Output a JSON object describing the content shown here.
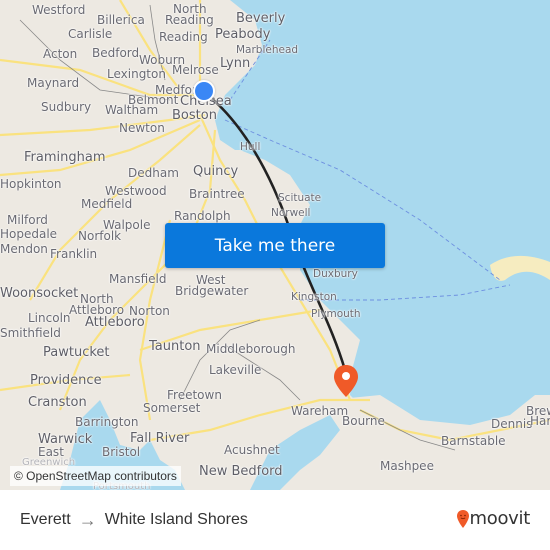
{
  "map": {
    "origin": {
      "name": "Everett",
      "marker_color": "#3a87f5"
    },
    "destination": {
      "name": "White Island Shores",
      "marker_color": "#f05a28"
    },
    "route_color": "#222222",
    "water_color": "#a9d9ee",
    "land_color": "#ede9e2",
    "road_color": "#fbe27a",
    "attribution": "© OpenStreetMap contributors",
    "places": [
      {
        "name": "Westford"
      },
      {
        "name": "North Reading"
      },
      {
        "name": "Beverly"
      },
      {
        "name": "Billerica"
      },
      {
        "name": "Carlisle"
      },
      {
        "name": "Reading"
      },
      {
        "name": "Peabody"
      },
      {
        "name": "Marblehead"
      },
      {
        "name": "Acton"
      },
      {
        "name": "Bedford"
      },
      {
        "name": "Woburn"
      },
      {
        "name": "Lynn"
      },
      {
        "name": "Maynard"
      },
      {
        "name": "Lexington"
      },
      {
        "name": "Melrose"
      },
      {
        "name": "Medford"
      },
      {
        "name": "Belmont"
      },
      {
        "name": "Chelsea"
      },
      {
        "name": "Sudbury"
      },
      {
        "name": "Waltham"
      },
      {
        "name": "Boston"
      },
      {
        "name": "Newton"
      },
      {
        "name": "Hull"
      },
      {
        "name": "Framingham"
      },
      {
        "name": "Dedham"
      },
      {
        "name": "Quincy"
      },
      {
        "name": "Hopkinton"
      },
      {
        "name": "Westwood"
      },
      {
        "name": "Braintree"
      },
      {
        "name": "Scituate"
      },
      {
        "name": "Medfield"
      },
      {
        "name": "Randolph"
      },
      {
        "name": "Norwell"
      },
      {
        "name": "Milford"
      },
      {
        "name": "Walpole"
      },
      {
        "name": "Hopedale"
      },
      {
        "name": "Norfolk"
      },
      {
        "name": "Mendon"
      },
      {
        "name": "Franklin"
      },
      {
        "name": "Mansfield"
      },
      {
        "name": "West Bridgewater"
      },
      {
        "name": "Duxbury"
      },
      {
        "name": "Woonsocket"
      },
      {
        "name": "North Attleboro"
      },
      {
        "name": "Kingston"
      },
      {
        "name": "Lincoln"
      },
      {
        "name": "Norton"
      },
      {
        "name": "Plymouth"
      },
      {
        "name": "Attleboro"
      },
      {
        "name": "Smithfield"
      },
      {
        "name": "Taunton"
      },
      {
        "name": "Middleborough"
      },
      {
        "name": "Pawtucket"
      },
      {
        "name": "Lakeville"
      },
      {
        "name": "Providence"
      },
      {
        "name": "Cranston"
      },
      {
        "name": "Freetown"
      },
      {
        "name": "Somerset"
      },
      {
        "name": "Wareham"
      },
      {
        "name": "Bourne"
      },
      {
        "name": "Barrington"
      },
      {
        "name": "Brewster"
      },
      {
        "name": "Dennis"
      },
      {
        "name": "Warwick"
      },
      {
        "name": "Fall River"
      },
      {
        "name": "Barnstable"
      },
      {
        "name": "East Greenwich"
      },
      {
        "name": "Bristol"
      },
      {
        "name": "Acushnet"
      },
      {
        "name": "Mashpee"
      },
      {
        "name": "New Bedford"
      },
      {
        "name": "Portsmouth"
      },
      {
        "name": "Harwich"
      }
    ]
  },
  "cta": {
    "label": "Take me there",
    "color": "#0a78dc"
  },
  "footer": {
    "from": "Everett",
    "arrow": "→",
    "to": "White Island Shores",
    "brand": "moovit",
    "brand_color": "#f05a28"
  }
}
